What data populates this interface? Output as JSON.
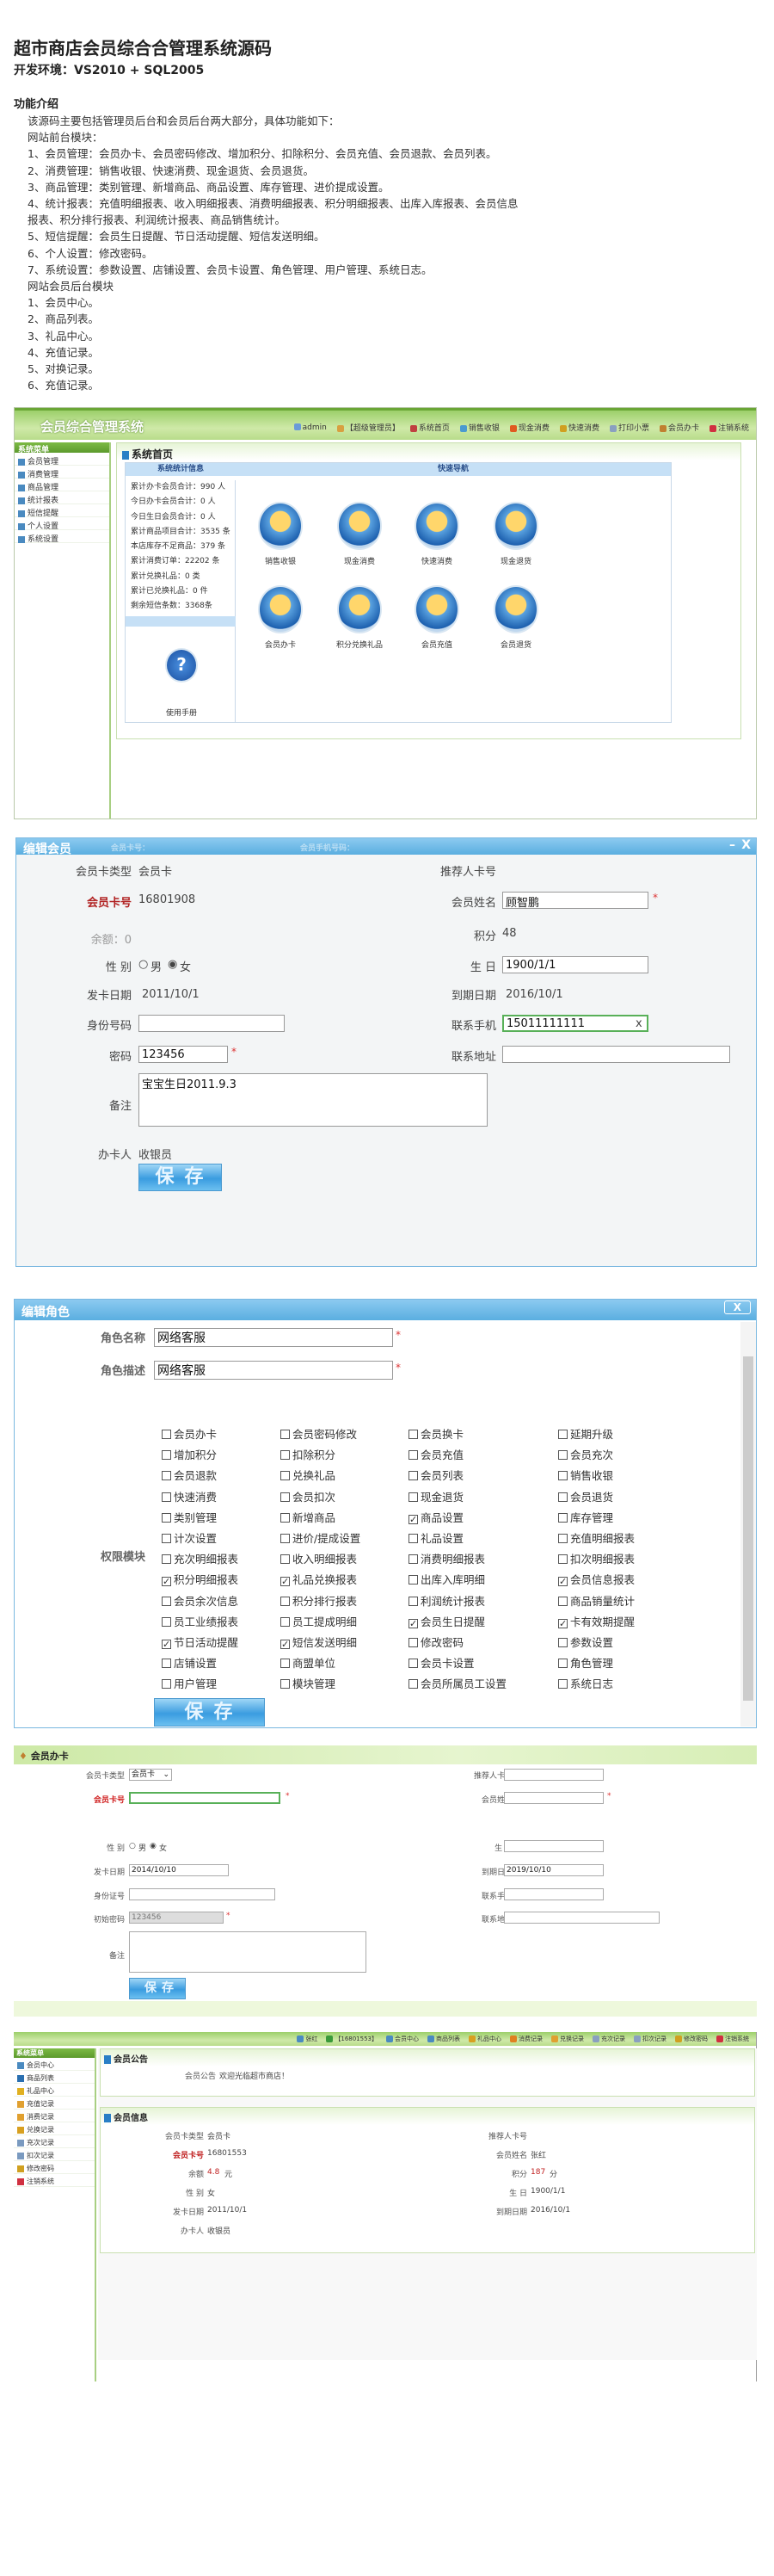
{
  "intro": {
    "title": "超市商店会员综合合管理系统源码",
    "env": "开发环境：VS2010 + SQL2005",
    "heading": "功能介绍",
    "lines": [
      "该源码主要包括管理员后台和会员后台两大部分，具体功能如下：",
      "网站前台模块：",
      "1、会员管理：会员办卡、会员密码修改、增加积分、扣除积分、会员充值、会员退款、会员列表。",
      "2、消费管理：销售收银、快速消费、现金退货、会员退货。",
      "3、商品管理：类别管理、新增商品、商品设置、库存管理、进价提成设置。",
      "4、统计报表：充值明细报表、收入明细报表、消费明细报表、积分明细报表、出库入库报表、会员信息",
      "报表、积分排行报表、利润统计报表、商品销售统计。",
      "5、短信提醒：会员生日提醒、节日活动提醒、短信发送明细。",
      "6、个人设置：修改密码。",
      "7、系统设置：参数设置、店铺设置、会员卡设置、角色管理、用户管理、系统日志。",
      "网站会员后台模块",
      "1、会员中心。",
      "2、商品列表。",
      "3、礼品中心。",
      "4、充值记录。",
      "5、对换记录。",
      "6、充值记录。"
    ]
  },
  "admin_home": {
    "logo": "会员综合管理系统",
    "nav": [
      "admin",
      "【超级管理员】",
      "系统首页",
      "销售收银",
      "现金消费",
      "快速消费",
      "打印小票",
      "会员办卡",
      "注销系统"
    ],
    "nav_colors": [
      "#6a9bd8",
      "#d8a040",
      "#c04040",
      "#4a9ad0",
      "#e05a20",
      "#d0a020",
      "#8aa0c0",
      "#c08030",
      "#d03040"
    ],
    "sidebar_header": "系统菜单",
    "sidebar": [
      "会员管理",
      "消费管理",
      "商品管理",
      "统计报表",
      "短信提醒",
      "个人设置",
      "系统设置"
    ],
    "panel_title": "系统首页",
    "stats_header": "系统统计信息",
    "nav_header": "快速导航",
    "stats": [
      "累计办卡会员合计：990 人",
      "今日办卡会员合计：0 人",
      "今日生日会员合计：0 人",
      "累计商品项目合计：3535 条",
      "本店库存不足商品：379 条",
      "累计消费订单：22202 条",
      "累计兑换礼品：0 类",
      "累计已兑换礼品：0 件",
      "剩余短信条数：3368条"
    ],
    "quick": [
      "销售收银",
      "现金消费",
      "快速消费",
      "现金退货",
      "会员办卡",
      "积分兑换礼品",
      "会员充值",
      "会员退货"
    ],
    "help": "使用手册"
  },
  "edit_member": {
    "title": "编辑会员",
    "bg_search": [
      "会员卡号：",
      "会员手机号码："
    ],
    "card_type_label": "会员卡类型",
    "card_type": "会员卡",
    "referrer_label": "推荐人卡号",
    "card_no_label": "会员卡号",
    "card_no": "16801908",
    "name_label": "会员姓名",
    "name": "顾智鹏",
    "balance": "余额：0",
    "points_label": "积分",
    "points": "48",
    "gender_label": "性 别",
    "male": "男",
    "female": "女",
    "birthday_label": "生 日",
    "birthday": "1900/1/1",
    "issue_label": "发卡日期",
    "issue": "2011/10/1",
    "expire_label": "到期日期",
    "expire": "2016/10/1",
    "id_label": "身份号码",
    "id": "",
    "phone_label": "联系手机",
    "phone": "15011111111",
    "pwd_label": "密码",
    "pwd": "123456",
    "addr_label": "联系地址",
    "addr": "",
    "note_label": "备注",
    "note": "宝宝生日2011.9.3",
    "operator_label": "办卡人",
    "operator": "收银员",
    "save": "保存",
    "required": "*",
    "clear": "x"
  },
  "edit_role": {
    "title": "编辑角色",
    "close": "X",
    "name_label": "角色名称",
    "name": "网络客服",
    "desc_label": "角色描述",
    "desc": "网络客服",
    "perm_label": "权限模块",
    "required": "*",
    "perms": [
      {
        "label": "会员办卡",
        "checked": false
      },
      {
        "label": "会员密码修改",
        "checked": false
      },
      {
        "label": "会员换卡",
        "checked": false
      },
      {
        "label": "延期升级",
        "checked": false
      },
      {
        "label": "增加积分",
        "checked": false
      },
      {
        "label": "扣除积分",
        "checked": false
      },
      {
        "label": "会员充值",
        "checked": false
      },
      {
        "label": "会员充次",
        "checked": false
      },
      {
        "label": "会员退款",
        "checked": false
      },
      {
        "label": "兑换礼品",
        "checked": false
      },
      {
        "label": "会员列表",
        "checked": false
      },
      {
        "label": "销售收银",
        "checked": false
      },
      {
        "label": "快速消费",
        "checked": false
      },
      {
        "label": "会员扣次",
        "checked": false
      },
      {
        "label": "现金退货",
        "checked": false
      },
      {
        "label": "会员退货",
        "checked": false
      },
      {
        "label": "类别管理",
        "checked": false
      },
      {
        "label": "新增商品",
        "checked": false
      },
      {
        "label": "商品设置",
        "checked": true
      },
      {
        "label": "库存管理",
        "checked": false
      },
      {
        "label": "计次设置",
        "checked": false
      },
      {
        "label": "进价/提成设置",
        "checked": false
      },
      {
        "label": "礼品设置",
        "checked": false
      },
      {
        "label": "充值明细报表",
        "checked": false
      },
      {
        "label": "充次明细报表",
        "checked": false
      },
      {
        "label": "收入明细报表",
        "checked": false
      },
      {
        "label": "消费明细报表",
        "checked": false
      },
      {
        "label": "扣次明细报表",
        "checked": false
      },
      {
        "label": "积分明细报表",
        "checked": true
      },
      {
        "label": "礼品兑换报表",
        "checked": true
      },
      {
        "label": "出库入库明细",
        "checked": false
      },
      {
        "label": "会员信息报表",
        "checked": true
      },
      {
        "label": "会员余次信息",
        "checked": false
      },
      {
        "label": "积分排行报表",
        "checked": false
      },
      {
        "label": "利润统计报表",
        "checked": false
      },
      {
        "label": "商品销量统计",
        "checked": false
      },
      {
        "label": "员工业绩报表",
        "checked": false
      },
      {
        "label": "员工提成明细",
        "checked": false
      },
      {
        "label": "会员生日提醒",
        "checked": true
      },
      {
        "label": "卡有效期提醒",
        "checked": true
      },
      {
        "label": "节日活动提醒",
        "checked": true
      },
      {
        "label": "短信发送明细",
        "checked": true
      },
      {
        "label": "修改密码",
        "checked": false
      },
      {
        "label": "参数设置",
        "checked": false
      },
      {
        "label": "店铺设置",
        "checked": false
      },
      {
        "label": "商盟单位",
        "checked": false
      },
      {
        "label": "会员卡设置",
        "checked": false
      },
      {
        "label": "角色管理",
        "checked": false
      },
      {
        "label": "用户管理",
        "checked": false
      },
      {
        "label": "模块管理",
        "checked": false
      },
      {
        "label": "会员所属员工设置",
        "checked": false
      },
      {
        "label": "系统日志",
        "checked": false
      }
    ],
    "save": "保存"
  },
  "new_card": {
    "title": "会员办卡",
    "card_type_label": "会员卡类型",
    "card_type": "会员卡",
    "referrer_label": "推荐人卡号",
    "card_no_label": "会员卡号",
    "name_label": "会员姓名",
    "gender_label": "性 别",
    "male": "男",
    "female": "女",
    "birthday_label": "生 日",
    "issue_label": "发卡日期",
    "issue": "2014/10/10",
    "expire_label": "到期日期",
    "expire": "2019/10/10",
    "id_label": "身份证号",
    "phone_label": "联系手机",
    "pwd_label": "初始密码",
    "pwd": "123456",
    "addr_label": "联系地址",
    "note_label": "备注",
    "required": "*",
    "save": "保存"
  },
  "member_center": {
    "nav": [
      "张红",
      "【16801553】",
      "会员中心",
      "商品列表",
      "礼品中心",
      "消费记录",
      "兑换记录",
      "充次记录",
      "扣次记录",
      "修改密码",
      "注销系统"
    ],
    "sidebar_header": "系统菜单",
    "sidebar": [
      "会员中心",
      "商品列表",
      "礼品中心",
      "充值记录",
      "消费记录",
      "兑换记录",
      "充次记录",
      "扣次记录",
      "修改密码",
      "注销系统"
    ],
    "notice_title": "会员公告",
    "notice_label": "会员公告",
    "notice": "欢迎光临超市商店！",
    "info_title": "会员信息",
    "fields": {
      "card_type_label": "会员卡类型",
      "card_type": "会员卡",
      "referrer_label": "推荐人卡号",
      "card_no_label": "会员卡号",
      "card_no": "16801553",
      "name_label": "会员姓名",
      "name": "张红",
      "balance_label": "余额",
      "balance": "4.8",
      "balance_unit": "元",
      "points_label": "积分",
      "points": "187",
      "points_unit": "分",
      "gender_label": "性 别",
      "gender": "女",
      "birthday_label": "生 日",
      "birthday": "1900/1/1",
      "issue_label": "发卡日期",
      "issue": "2011/10/1",
      "expire_label": "到期日期",
      "expire": "2016/10/1",
      "operator_label": "办卡人",
      "operator": "收银员"
    }
  }
}
